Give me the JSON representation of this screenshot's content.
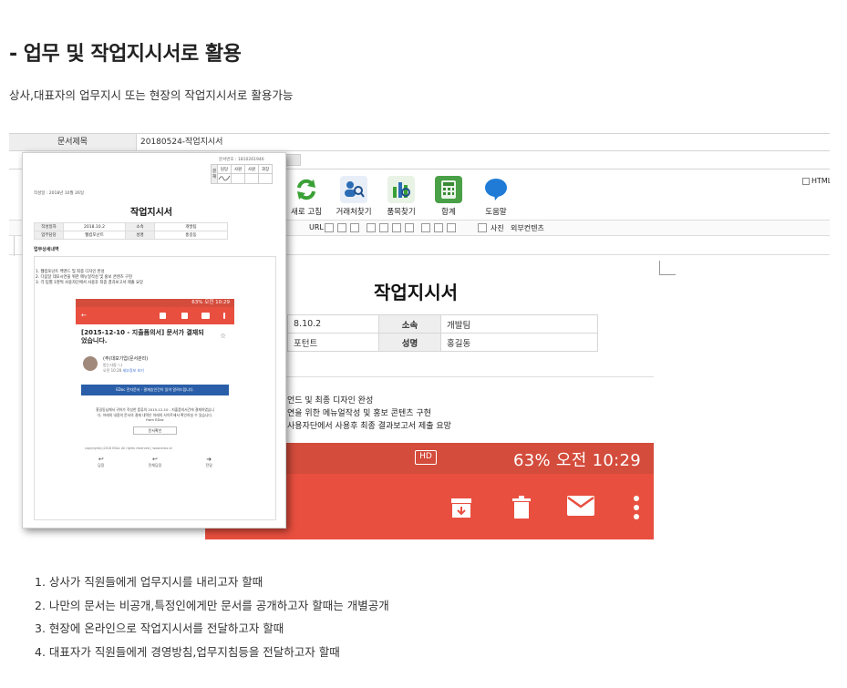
{
  "page": {
    "heading": "- 업무 및 작업지시서로 활용",
    "subtitle": "상사,대표자의 업무지시 또는 현장의 작업지시서로 활용가능"
  },
  "editor": {
    "doc_title_label": "문서제목",
    "doc_title_value": "20180524-작업지시서",
    "html_checkbox_label": "HTML",
    "toolbar_buttons": [
      "새로 고침",
      "거래처찾기",
      "품목찾기",
      "합계",
      "도움말"
    ],
    "format_bar": {
      "url_label": "URL",
      "photo_label": "사진",
      "external_content_label": "외부컨텐츠"
    },
    "preview": {
      "title": "작업지시서",
      "rows": [
        {
          "value": "8.10.2",
          "label": "소속",
          "value2": "개발팀"
        },
        {
          "value": "포턴트",
          "label": "성명",
          "value2": "홍길동"
        }
      ],
      "lines": [
        "언드 및 최종 디자인 완성",
        "연을 위한 메뉴얼작성 및 홍보 콘텐츠 구현",
        "사용자단에서 사용후 최종 결과보고서 제출 요망"
      ],
      "status_hd": "HD",
      "status_text": "63% 오전 10:29"
    }
  },
  "document": {
    "doc_number": "문서번호 : 1810261946",
    "approval": {
      "side": "결재",
      "headers": [
        "담당",
        "사원",
        "사원",
        "과장"
      ]
    },
    "written_date": "작성일 : 2018년 10월 26일",
    "title": "작업지시서",
    "info_rows": [
      {
        "h1": "작성일자",
        "v1": "2018.10.2",
        "h2": "소속",
        "v2": "개발팀"
      },
      {
        "h1": "업무담당",
        "v1": "웹컴포넌트",
        "h2": "성명",
        "v2": "홍길동"
      }
    ],
    "section_title": "업무상세내역",
    "lines": [
      "1. 웹컴포넌트 백엔드 및 최종 디자인 완성",
      "2. 다음달 데모시연을 위한 메뉴얼작성 및 홍보 콘텐츠 구현",
      "3. 각 팀별 1명씩 사용자단에서 사용후 최종 결과보고서 제출 요망"
    ],
    "phone": {
      "status": "63% 오전 10:29",
      "subject": "[2015-12-10 - 지출품의서] 문서가 결재되었습니다.",
      "sender": "(주)대모기업(문서관리)",
      "recipient": "받는사람: 나",
      "time": "오전 10:28",
      "detail_link": "세부정보 보기",
      "banner": "EDoc 전자문서 - 결재승인건이 있어 알려드립니다.",
      "body": "홍길동님께서 귀하가 작성한 품류의 2015-12-10 - 지출품의서건에 결재하였습니다. 아래의 내용의 문서의 결재 내역은 아래의 사이트에서 확인하실 수 있습니다. from EDoc",
      "button": "문서확인",
      "copyright": "copyright(c)2018 EDoc All rights reserved | www.edoc.kr",
      "actions": [
        "답장",
        "전체답장",
        "전달"
      ]
    }
  },
  "uses": [
    "1. 상사가 직원들에게 업무지시를 내리고자 할때",
    "2. 나만의 문서는 비공개,특정인에게만 문서를 공개하고자 할때는 개별공개",
    "3. 현장에 온라인으로 작업지시서를 전달하고자 할때",
    "4. 대표자가 직원들에게 경영방침,업무지침등을 전달하고자 할때"
  ]
}
